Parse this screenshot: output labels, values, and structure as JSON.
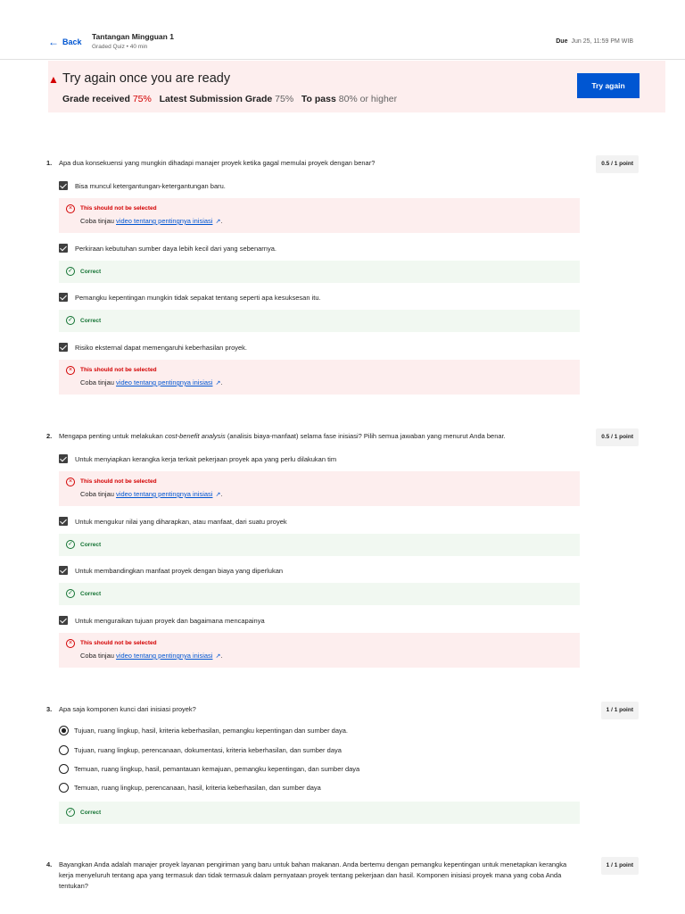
{
  "header": {
    "back_label": "Back",
    "title": "Tantangan Mingguan 1",
    "subtitle": "Graded Quiz • 40 min",
    "due_label": "Due",
    "due_value": "Jun 25, 11:59 PM WIB"
  },
  "banner": {
    "heading": "Try again once you are ready",
    "grade_received_label": "Grade received",
    "grade_received_value": "75%",
    "latest_label": "Latest Submission Grade",
    "latest_value": "75%",
    "pass_label": "To pass",
    "pass_value": "80% or higher",
    "try_again_label": "Try again"
  },
  "feedback": {
    "wrong_label": "This should not be selected",
    "correct_label": "Correct",
    "hint_prefix": "Coba tinjau",
    "hint_link": "video tentang pentingnya inisiasi",
    "hint_suffix": "."
  },
  "questions": [
    {
      "number": "1.",
      "text": "Apa dua konsekuensi yang mungkin dihadapi manajer proyek ketika gagal memulai proyek dengan benar?",
      "points": "0.5 / 1 point",
      "options": [
        "Bisa muncul ketergantungan-ketergantungan baru.",
        "Perkiraan kebutuhan sumber daya lebih kecil dari yang sebenarnya.",
        "Pemangku kepentingan mungkin tidak sepakat tentang seperti apa kesuksesan itu.",
        "Risiko eksternal dapat memengaruhi keberhasilan proyek."
      ]
    },
    {
      "number": "2.",
      "text_before": "Mengapa penting untuk melakukan",
      "text_italic": "cost-benefit analysis",
      "text_after": "(analisis biaya-manfaat) selama fase inisiasi? Pilih semua jawaban yang menurut Anda benar.",
      "points": "0.5 / 1 point",
      "options": [
        "Untuk menyiapkan kerangka kerja terkait pekerjaan proyek apa yang perlu dilakukan tim",
        "Untuk mengukur nilai yang diharapkan, atau manfaat, dari suatu proyek",
        "Untuk membandingkan manfaat proyek dengan biaya yang diperlukan",
        "Untuk menguraikan tujuan proyek dan bagaimana mencapainya"
      ]
    },
    {
      "number": "3.",
      "text": "Apa saja komponen kunci dari inisiasi proyek?",
      "points": "1 / 1 point",
      "options": [
        "Tujuan, ruang lingkup, hasil, kriteria keberhasilan, pemangku kepentingan dan sumber daya.",
        "Tujuan, ruang lingkup, perencanaan, dokumentasi, kriteria keberhasilan, dan sumber daya",
        "Temuan, ruang lingkup, hasil, pemantauan kemajuan, pemangku kepentingan, dan sumber daya",
        "Temuan, ruang lingkup, perencanaan, hasil, kriteria keberhasilan, dan sumber daya"
      ]
    },
    {
      "number": "4.",
      "text": "Bayangkan Anda adalah manajer proyek layanan pengiriman yang baru untuk bahan makanan. Anda bertemu dengan pemangku kepentingan untuk menetapkan kerangka kerja menyeluruh tentang apa yang termasuk dan tidak termasuk dalam pernyataan proyek tentang pekerjaan dan hasil. Komponen inisiasi proyek mana yang coba Anda tentukan?",
      "points": "1 / 1 point"
    }
  ]
}
